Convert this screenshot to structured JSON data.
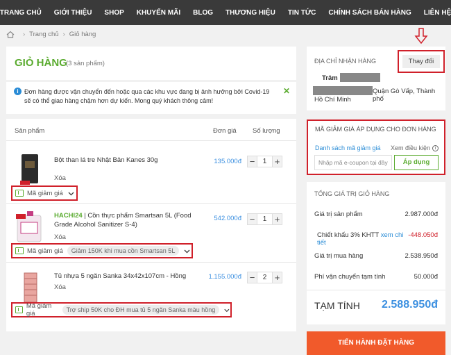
{
  "nav": [
    "TRANG CHỦ",
    "GIỚI THIỆU",
    "SHOP",
    "KHUYẾN MÃI",
    "BLOG",
    "THƯƠNG HIỆU",
    "TIN TỨC",
    "CHÍNH SÁCH BÁN HÀNG",
    "LIÊN HỆ"
  ],
  "breadcrumb": {
    "home": "Trang chủ",
    "current": "Giỏ hàng"
  },
  "cart": {
    "title": "GIỎ HÀNG",
    "count": "(3 sản phẩm)"
  },
  "notice": {
    "text": "Đơn hàng được vận chuyển đến hoặc qua các khu vực đang bị ảnh hưởng bởi Covid-19 sẽ có thể giao hàng chậm hơn dự kiến. Mong quý khách thông cảm!",
    "close": "✕"
  },
  "table": {
    "col_product": "Sản phẩm",
    "col_price": "Đơn giá",
    "col_qty": "Số lượng"
  },
  "products": [
    {
      "name": "Bột than lá tre Nhật Bản Kanes 30g",
      "remove": "Xóa",
      "price": "135.000đ",
      "qty": "1",
      "promo_label": "Mã giảm giá",
      "promo_pill": ""
    },
    {
      "brand": "HACHI24",
      "name": " | Cồn thực phẩm Smartsan 5L (Food Grade Alcohol Sanitizer S-4)",
      "remove": "Xóa",
      "price": "542.000đ",
      "qty": "1",
      "promo_label": "Mã giảm giá",
      "promo_pill": "Giảm 150K khi mua cồn Smartsan 5L"
    },
    {
      "name": "Tủ nhựa 5 ngăn Sanka 34x42x107cm - Hồng",
      "remove": "Xóa",
      "price": "1.155.000đ",
      "qty": "2",
      "promo_label": "Mã giảm giá",
      "promo_pill": "Trợ ship 50K cho ĐH mua tủ 5 ngăn Sanka màu hồng"
    }
  ],
  "qty_minus": "−",
  "qty_plus": "+",
  "address": {
    "label": "ĐỊA CHỈ NHẬN HÀNG",
    "change": "Thay đổi",
    "name": "Trâm",
    "line2": "Quận Gò Vấp, Thành phố",
    "line3": "Hồ Chí Minh"
  },
  "coupon": {
    "title": "MÃ GIẢM GIÁ ÁP DỤNG CHO ĐƠN HÀNG",
    "list_link": "Danh sách mã giảm giá",
    "conditions": "Xem điều kiện",
    "placeholder": "Nhập mã e-coupon tại đây",
    "apply": "Áp dụng"
  },
  "totals": {
    "title": "TỔNG GIÁ TRỊ GIỎ HÀNG",
    "subtotal_label": "Giá trị sản phẩm",
    "subtotal": "2.987.000đ",
    "discount_label": "Chiết khấu 3% KHTT",
    "discount_link": "xem chi tiết",
    "discount": "-448.050đ",
    "purchase_label": "Giá trị mua hàng",
    "purchase": "2.538.950đ",
    "shipping_label": "Phí vận chuyển tạm tính",
    "shipping": "50.000đ",
    "final_label": "TẠM TÍNH",
    "final": "2.588.950đ"
  },
  "checkout": "TIẾN HÀNH ĐẶT HÀNG",
  "colors": {
    "accent": "#5aab2f",
    "link": "#3b8fe0",
    "cta": "#f15a2b",
    "highlight": "#d0202a",
    "nav_bg": "#3a3a3a"
  }
}
